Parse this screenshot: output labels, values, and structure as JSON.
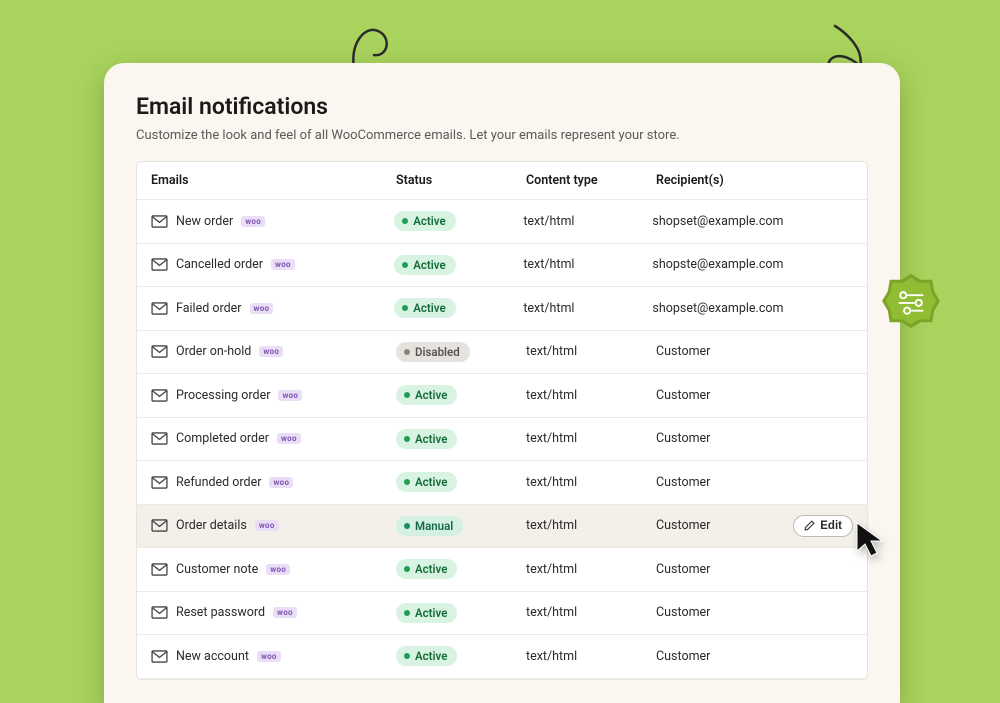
{
  "page": {
    "title": "Email notifications",
    "subtitle": "Customize the look and feel of all WooCommerce emails. Let your emails represent your store."
  },
  "table": {
    "headers": {
      "emails": "Emails",
      "status": "Status",
      "content_type": "Content type",
      "recipients": "Recipient(s)"
    },
    "woo_tag": "woo",
    "edit_label": "Edit",
    "status_labels": {
      "active": "Active",
      "disabled": "Disabled",
      "manual": "Manual"
    },
    "rows": [
      {
        "name": "New order",
        "status": "active",
        "content_type": "text/html",
        "recipient": "shopset@example.com"
      },
      {
        "name": "Cancelled order",
        "status": "active",
        "content_type": "text/html",
        "recipient": "shopste@example.com"
      },
      {
        "name": "Failed order",
        "status": "active",
        "content_type": "text/html",
        "recipient": "shopset@example.com"
      },
      {
        "name": "Order on-hold",
        "status": "disabled",
        "content_type": "text/html",
        "recipient": "Customer"
      },
      {
        "name": "Processing order",
        "status": "active",
        "content_type": "text/html",
        "recipient": "Customer"
      },
      {
        "name": "Completed order",
        "status": "active",
        "content_type": "text/html",
        "recipient": "Customer"
      },
      {
        "name": "Refunded order",
        "status": "active",
        "content_type": "text/html",
        "recipient": "Customer"
      },
      {
        "name": "Order details",
        "status": "manual",
        "content_type": "text/html",
        "recipient": "Customer",
        "highlight": true,
        "show_edit": true
      },
      {
        "name": "Customer note",
        "status": "active",
        "content_type": "text/html",
        "recipient": "Customer"
      },
      {
        "name": "Reset password",
        "status": "active",
        "content_type": "text/html",
        "recipient": "Customer"
      },
      {
        "name": "New account",
        "status": "active",
        "content_type": "text/html",
        "recipient": "Customer"
      }
    ]
  }
}
